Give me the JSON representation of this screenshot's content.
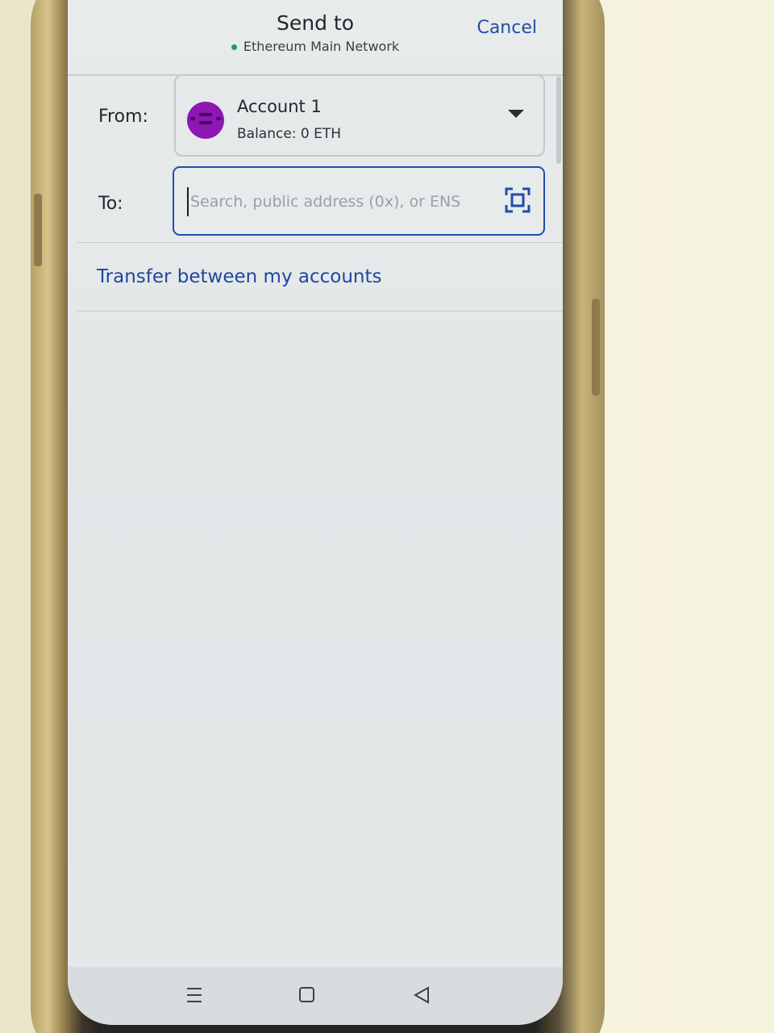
{
  "header": {
    "title": "Send to",
    "network": "Ethereum Main Network",
    "cancel_label": "Cancel"
  },
  "from": {
    "label": "From:",
    "account_name": "Account 1",
    "balance": "Balance: 0 ETH"
  },
  "to": {
    "label": "To:",
    "placeholder": "Search, public address (0x), or ENS",
    "value": ""
  },
  "transfer_link": "Transfer between my accounts",
  "icons": {
    "network_status": "status-dot-icon",
    "avatar": "identicon-avatar",
    "dropdown": "caret-down-icon",
    "scan": "qr-scan-icon",
    "nav_menu": "recent-apps-icon",
    "nav_home": "home-icon",
    "nav_back": "back-icon"
  },
  "colors": {
    "accent_blue": "#1d4fa8",
    "network_green": "#1e9d5b",
    "avatar_purple": "#8d16b5"
  }
}
